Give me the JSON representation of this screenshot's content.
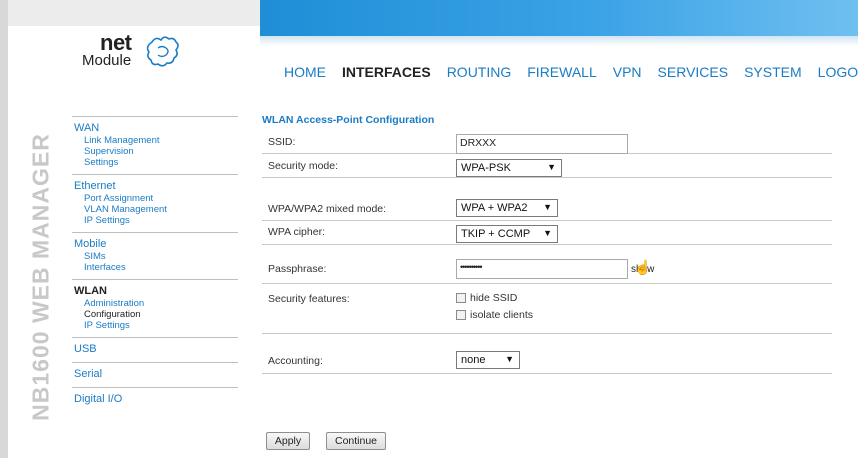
{
  "brand": {
    "logo_net": "net",
    "logo_module": "Module",
    "vertical_text": "NB1600 WEB MANAGER",
    "accent_color": "#1a7cc5"
  },
  "topnav": {
    "items": [
      "HOME",
      "INTERFACES",
      "ROUTING",
      "FIREWALL",
      "VPN",
      "SERVICES",
      "SYSTEM",
      "LOGOUT"
    ],
    "active": "INTERFACES"
  },
  "sidebar": {
    "groups": [
      {
        "title": "WAN",
        "items": [
          "Link Management",
          "Supervision",
          "Settings"
        ]
      },
      {
        "title": "Ethernet",
        "items": [
          "Port Assignment",
          "VLAN Management",
          "IP Settings"
        ]
      },
      {
        "title": "Mobile",
        "items": [
          "SIMs",
          "Interfaces"
        ]
      },
      {
        "title": "WLAN",
        "items": [
          "Administration",
          "Configuration",
          "IP Settings"
        ],
        "active": true,
        "active_item": "Configuration"
      },
      {
        "title": "USB",
        "items": []
      },
      {
        "title": "Serial",
        "items": []
      },
      {
        "title": "Digital I/O",
        "items": []
      }
    ]
  },
  "form": {
    "section_title": "WLAN Access-Point Configuration",
    "ssid_label": "SSID:",
    "ssid_value": "DRXXX",
    "security_mode_label": "Security mode:",
    "security_mode_value": "WPA-PSK",
    "mixed_mode_label": "WPA/WPA2 mixed mode:",
    "mixed_mode_value": "WPA + WPA2",
    "cipher_label": "WPA cipher:",
    "cipher_value": "TKIP + CCMP",
    "passphrase_label": "Passphrase:",
    "passphrase_value": "••••••••••",
    "show_label": "show",
    "security_features_label": "Security features:",
    "hide_ssid_label": "hide SSID",
    "isolate_clients_label": "isolate clients",
    "accounting_label": "Accounting:",
    "accounting_value": "none",
    "apply_label": "Apply",
    "continue_label": "Continue"
  }
}
